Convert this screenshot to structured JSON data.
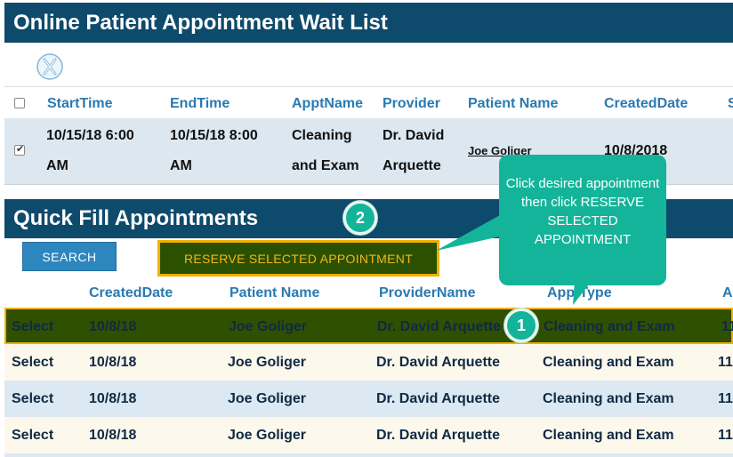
{
  "header": {
    "title": "Online Patient Appointment Wait List"
  },
  "wait_list": {
    "columns": [
      "StartTime",
      "EndTime",
      "ApptName",
      "Provider",
      "Patient Name",
      "CreatedDate",
      "S"
    ],
    "rows": [
      {
        "start_line1": "10/15/18 6:00",
        "start_line2": "AM",
        "end_line1": "10/15/18 8:00",
        "end_line2": "AM",
        "appt_line1": "Cleaning",
        "appt_line2": "and Exam",
        "provider_line1": "Dr. David",
        "provider_line2": "Arquette",
        "patient": "Joe Goliger",
        "created": "10/8/2018"
      }
    ]
  },
  "quick_fill": {
    "title": "Quick Fill Appointments",
    "search_label": "SEARCH",
    "reserve_label": "RESERVE SELECTED APPOINTMENT",
    "columns": [
      "CreatedDate",
      "Patient Name",
      "ProviderName",
      "ApptType",
      "A"
    ],
    "rows": [
      {
        "select": "Select",
        "created": "10/8/18",
        "patient": "Joe Goliger",
        "provider": "Dr. David Arquette",
        "type": "Cleaning and Exam",
        "extra": "11"
      },
      {
        "select": "Select",
        "created": "10/8/18",
        "patient": "Joe Goliger",
        "provider": "Dr. David Arquette",
        "type": "Cleaning and Exam",
        "extra": "11/"
      },
      {
        "select": "Select",
        "created": "10/8/18",
        "patient": "Joe Goliger",
        "provider": "Dr. David Arquette",
        "type": "Cleaning and Exam",
        "extra": "11/"
      },
      {
        "select": "Select",
        "created": "10/8/18",
        "patient": "Joe Goliger",
        "provider": "Dr. David Arquette",
        "type": "Cleaning and Exam",
        "extra": "11/"
      }
    ]
  },
  "callout": {
    "text": "Click desired appointment then click RESERVE SELECTED APPOINTMENT",
    "badge_1": "1",
    "badge_2": "2"
  },
  "colors": {
    "header_band": "#0e4a6b",
    "callout": "#14b49a",
    "selected_row": "#2e5000",
    "highlight_border": "#f0b000",
    "search_button": "#2e86bf"
  }
}
